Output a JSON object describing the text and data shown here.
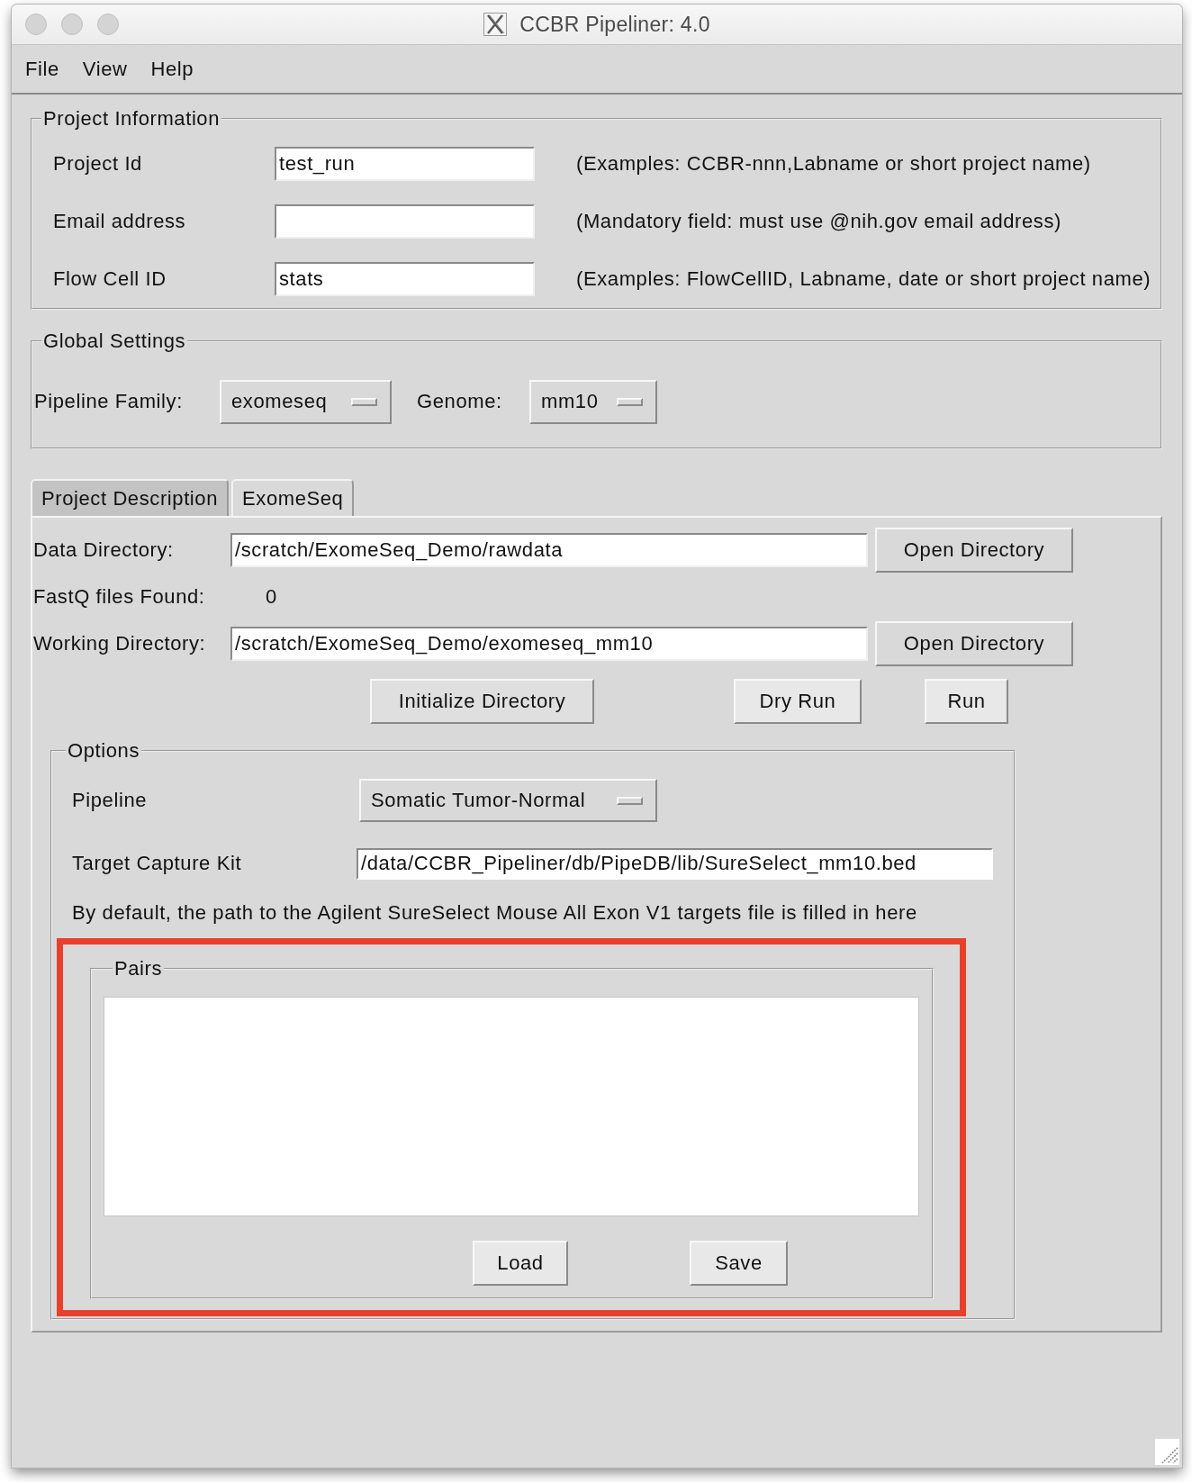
{
  "window": {
    "title": "CCBR Pipeliner: 4.0"
  },
  "menu": [
    "File",
    "View",
    "Help"
  ],
  "project_information": {
    "title": "Project Information",
    "fields": [
      {
        "label": "Project Id",
        "value": "test_run",
        "hint": "(Examples: CCBR-nnn,Labname or short project name)"
      },
      {
        "label": "Email address",
        "hint": "(Mandatory field: must use @nih.gov email address)"
      },
      {
        "label": "Flow Cell ID",
        "value": "stats",
        "hint": "(Examples: FlowCellID, Labname, date or short project name)"
      }
    ]
  },
  "global_settings": {
    "title": "Global Settings",
    "pipeline_family": {
      "label": "Pipeline Family:",
      "value": "exomeseq"
    },
    "genome": {
      "label": "Genome:",
      "value": "mm10"
    }
  },
  "tabs": [
    {
      "label": "Project Description",
      "selected": false
    },
    {
      "label": "ExomeSeq",
      "selected": true
    }
  ],
  "exomeseq_tab": {
    "data_directory": {
      "label": "Data Directory:",
      "value": "/scratch/ExomeSeq_Demo/rawdata",
      "button": "Open Directory"
    },
    "fastq_found": {
      "label": "FastQ files Found:",
      "value": "0"
    },
    "working_directory": {
      "label": "Working Directory:",
      "value": "/scratch/ExomeSeq_Demo/exomeseq_mm10",
      "button": "Open Directory"
    },
    "actions": [
      "Initialize Directory",
      "Dry Run",
      "Run"
    ],
    "options": {
      "title": "Options",
      "pipeline": {
        "label": "Pipeline",
        "value": "Somatic Tumor-Normal"
      },
      "target_capture_kit": {
        "label": "Target Capture Kit",
        "value": "/data/CCBR_Pipeliner/db/PipeDB/lib/SureSelect_mm10.bed"
      },
      "note": "By default, the path to the Agilent SureSelect Mouse All Exon V1 targets file is filled in here",
      "pairs": {
        "title": "Pairs",
        "highlighted": true,
        "buttons": [
          "Load",
          "Save"
        ]
      }
    }
  }
}
